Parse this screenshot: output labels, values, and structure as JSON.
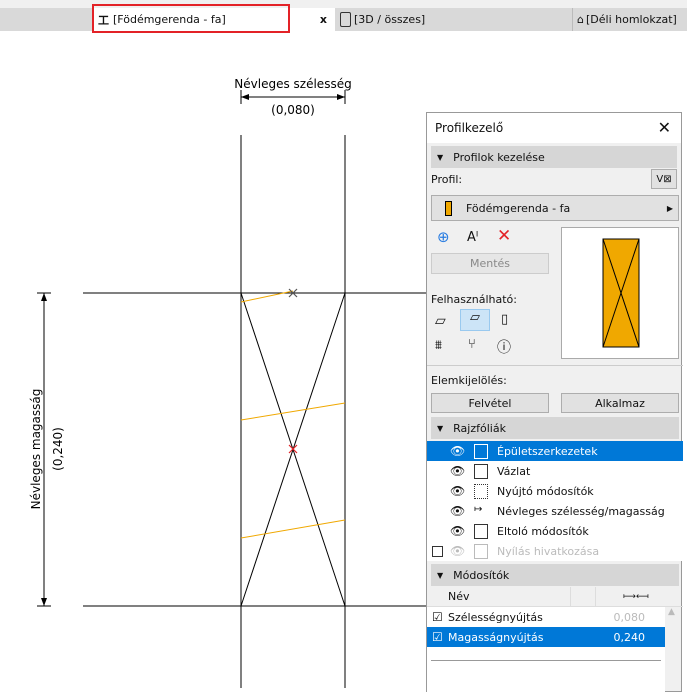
{
  "tabs": [
    {
      "label": "[Födémgerenda - fa]",
      "icon": "beam-profile-icon",
      "active": true,
      "close": "x"
    },
    {
      "label": "[3D / összes]",
      "icon": "3d-box-icon"
    },
    {
      "label": "[Déli homlokzat]",
      "icon": "house-elevation-icon"
    }
  ],
  "drawing": {
    "width_label": "Névleges szélesség",
    "width_value": "(0,080)",
    "height_label": "Névleges magasság",
    "height_value": "(0,240)"
  },
  "panel": {
    "title": "Profilkezelő",
    "section1": "Profilok kezelése",
    "profile_label": "Profil:",
    "profile_name": "Födémgerenda - fa",
    "save": "Mentés",
    "usable_label": "Felhasználható:",
    "selection_label": "Elemkijelölés:",
    "pick": "Felvétel",
    "apply": "Alkalmaz",
    "section2": "Rajzfóliák",
    "layers": [
      {
        "label": "Épületszerkezetek",
        "visible": true,
        "selected": true
      },
      {
        "label": "Vázlat",
        "visible": true
      },
      {
        "label": "Nyújtó módosítók",
        "visible": true
      },
      {
        "label": "Névleges szélesség/magasság",
        "visible": true
      },
      {
        "label": "Eltoló módosítók",
        "visible": true
      },
      {
        "label": "Nyílás hivatkozása",
        "visible": false,
        "disabled": true
      }
    ],
    "section3": "Módosítók",
    "mod_header": "Név",
    "modifiers": [
      {
        "name": "Szélességnyújtás",
        "value": "0,080",
        "checked": true
      },
      {
        "name": "Magasságnyújtás",
        "value": "0,240",
        "checked": true,
        "selected": true
      }
    ]
  },
  "colors": {
    "accent": "#0078d7",
    "hatch": "#f0a800",
    "highlight": "#e32227"
  }
}
